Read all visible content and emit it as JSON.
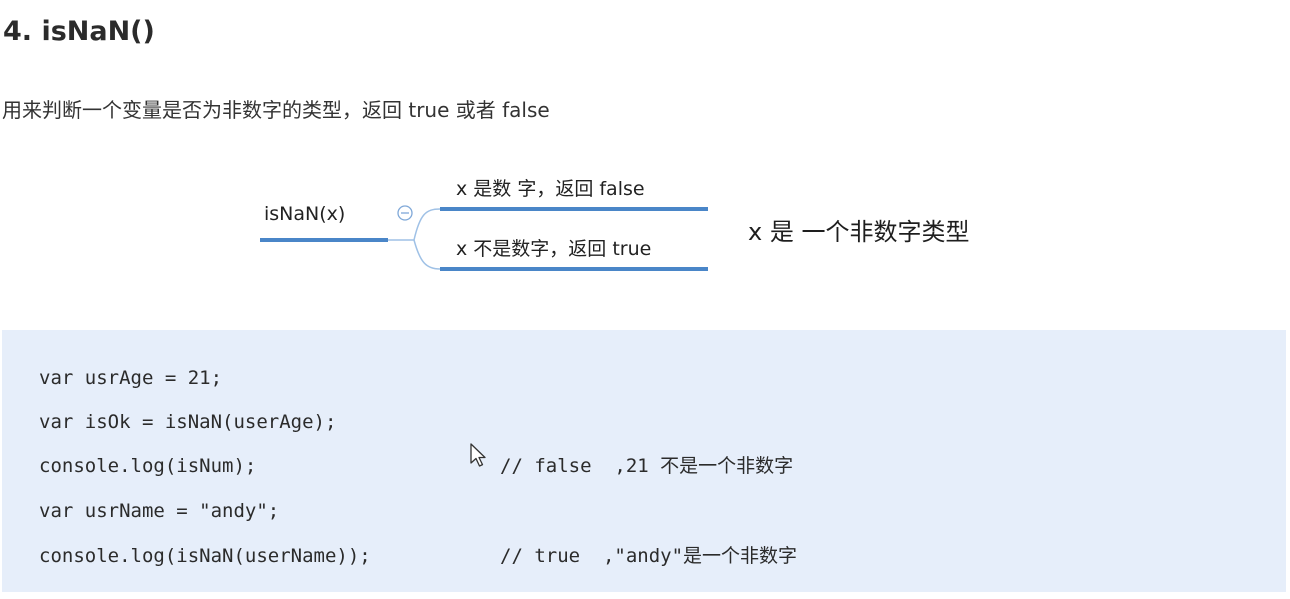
{
  "heading": "4. isNaN()",
  "description": "用来判断一个变量是否为非数字的类型，返回 true 或者 false",
  "mindmap": {
    "root": "isNaN(x)",
    "collapse_icon": "minus-circle-icon",
    "branches": [
      {
        "label": "x 是数 字，返回 false"
      },
      {
        "label": "x 不是数字，返回 true"
      }
    ],
    "note": "x 是 一个非数字类型",
    "line_color": "#4a86c8"
  },
  "code": {
    "background": "#e6eefa",
    "lines": [
      {
        "code": "var usrAge = 21;",
        "comment": ""
      },
      {
        "code": "var isOk = isNaN(userAge);",
        "comment": ""
      },
      {
        "code": "console.log(isNum);",
        "comment": "// false  ,21 不是一个非数字"
      },
      {
        "code": "var usrName = \"andy\";",
        "comment": ""
      },
      {
        "code": "console.log(isNaN(userName));",
        "comment": "// true  ,\"andy\"是一个非数字"
      }
    ]
  },
  "cursor_icon": "mouse-pointer-icon"
}
